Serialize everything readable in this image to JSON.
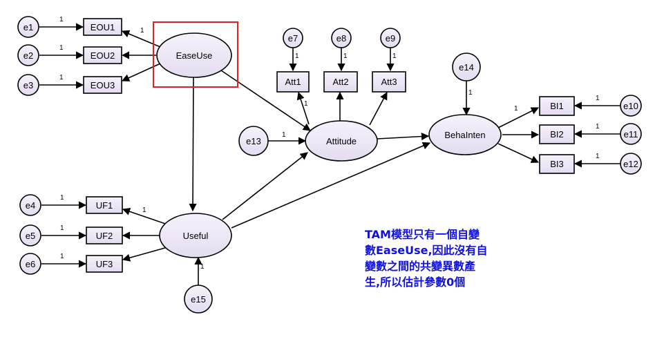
{
  "latent": {
    "easeuse": "EaseUse",
    "useful": "Useful",
    "attitude": "Attitude",
    "behainten": "BehaInten"
  },
  "indicators": {
    "eou1": "EOU1",
    "eou2": "EOU2",
    "eou3": "EOU3",
    "uf1": "UF1",
    "uf2": "UF2",
    "uf3": "UF3",
    "att1": "Att1",
    "att2": "Att2",
    "att3": "Att3",
    "bi1": "BI1",
    "bi2": "BI2",
    "bi3": "BI3"
  },
  "errors": {
    "e1": "e1",
    "e2": "e2",
    "e3": "e3",
    "e4": "e4",
    "e5": "e5",
    "e6": "e6",
    "e7": "e7",
    "e8": "e8",
    "e9": "e9",
    "e10": "e10",
    "e11": "e11",
    "e12": "e12",
    "e13": "e13",
    "e14": "e14",
    "e15": "e15"
  },
  "weights": {
    "fixed": "1"
  },
  "note": "TAM模型只有一個自變\n數EaseUse,因此沒有自\n變數之間的共變異數產\n生,所以估計參數0個",
  "colors": {
    "node_fill": "#ede6f5",
    "highlight": "#e02020",
    "note_text": "#1010e0"
  }
}
